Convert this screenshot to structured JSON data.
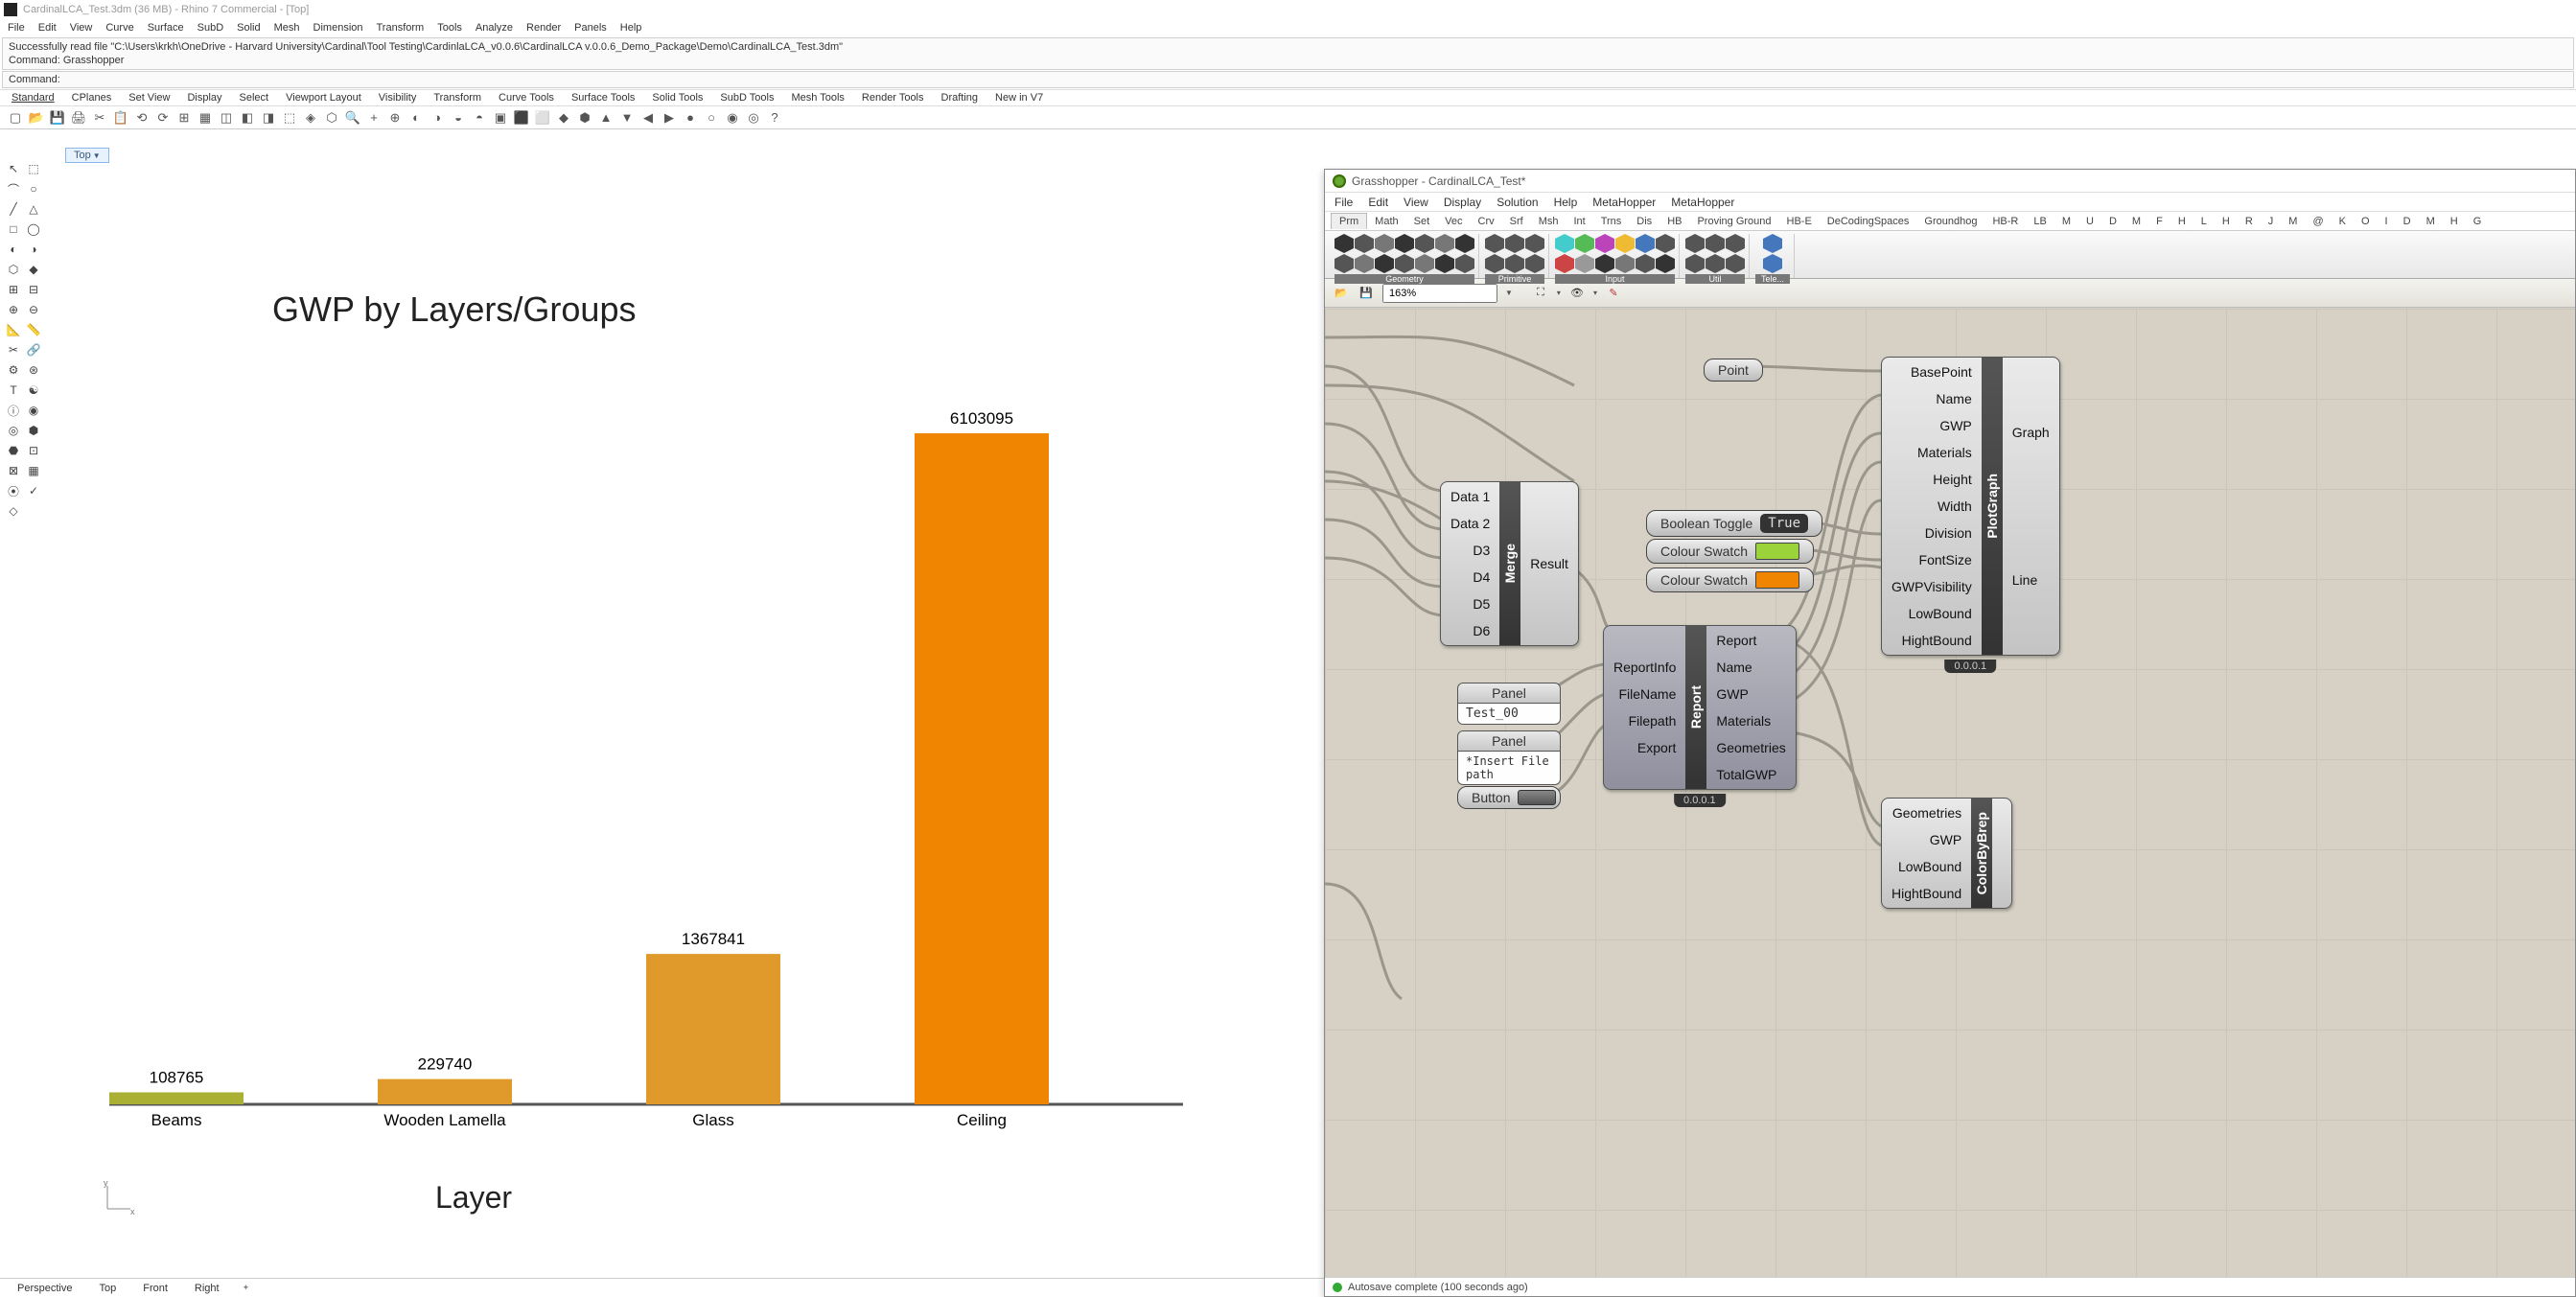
{
  "title": "CardinalLCA_Test.3dm (36 MB) - Rhino 7 Commercial - [Top]",
  "rhmenu": [
    "File",
    "Edit",
    "View",
    "Curve",
    "Surface",
    "SubD",
    "Solid",
    "Mesh",
    "Dimension",
    "Transform",
    "Tools",
    "Analyze",
    "Render",
    "Panels",
    "Help"
  ],
  "cmd_line1": "Successfully read file \"C:\\Users\\krkh\\OneDrive - Harvard University\\Cardinal\\Tool Testing\\CardinlaLCA_v0.0.6\\CardinalLCA v.0.0.6_Demo_Package\\Demo\\CardinalLCA_Test.3dm\"",
  "cmd_line2": "Command: Grasshopper",
  "cmd_prompt": "Command:",
  "tabtoolbar": [
    "Standard",
    "CPlanes",
    "Set View",
    "Display",
    "Select",
    "Viewport Layout",
    "Visibility",
    "Transform",
    "Curve Tools",
    "Surface Tools",
    "Solid Tools",
    "SubD Tools",
    "Mesh Tools",
    "Render Tools",
    "Drafting",
    "New in V7"
  ],
  "viewlabel": "Top",
  "chart_data": {
    "type": "bar",
    "title": "GWP by Layers/Groups",
    "xlabel": "Layer",
    "categories": [
      "Beams",
      "Wooden Lamella",
      "Glass",
      "Ceiling"
    ],
    "values": [
      108765,
      229740,
      1367841,
      6103095
    ],
    "colors": [
      "#aab033",
      "#e09a2b",
      "#e09a2b",
      "#ef8500"
    ]
  },
  "footer_tabs": [
    "Perspective",
    "Top",
    "Front",
    "Right"
  ],
  "gh": {
    "title": "Grasshopper - CardinalLCA_Test*",
    "menu": [
      "File",
      "Edit",
      "View",
      "Display",
      "Solution",
      "Help",
      "MetaHopper",
      "MetaHopper"
    ],
    "tabs": [
      "Prm",
      "Math",
      "Set",
      "Vec",
      "Crv",
      "Srf",
      "Msh",
      "Int",
      "Trns",
      "Dis",
      "HB",
      "Proving Ground",
      "HB-E",
      "DeCodingSpaces",
      "Groundhog",
      "HB-R",
      "LB",
      "M",
      "U",
      "D",
      "M",
      "F",
      "H",
      "L",
      "H",
      "R",
      "J",
      "M",
      "@",
      "K",
      "O",
      "I",
      "D",
      "M",
      "H",
      "G"
    ],
    "ribbon_groups": [
      "Geometry",
      "Primitive",
      "Input",
      "Util",
      "Tele..."
    ],
    "zoom": "163%",
    "status": "Autosave complete (100 seconds ago)",
    "point_label": "Point",
    "bool_toggle": {
      "label": "Boolean Toggle",
      "value": "True"
    },
    "swatch1_label": "Colour Swatch",
    "swatch2_label": "Colour Swatch",
    "swatch1_color": "#9bd33b",
    "swatch2_color": "#ef8500",
    "merge": {
      "inputs": [
        "Data 1",
        "Data 2",
        "D3",
        "D4",
        "D5",
        "D6"
      ],
      "name": "Merge",
      "out": "Result"
    },
    "panel1": {
      "hdr": "Panel",
      "body": "Test_00"
    },
    "panel2": {
      "hdr": "Panel",
      "body": "*Insert File path"
    },
    "button_label": "Button",
    "report": {
      "name": "Report",
      "ver": "0.0.0.1",
      "inputs": [
        "ReportInfo",
        "FileName",
        "Filepath",
        "Export"
      ],
      "outputs": [
        "Report",
        "Name",
        "GWP",
        "Materials",
        "Geometries",
        "TotalGWP"
      ]
    },
    "plotgraph": {
      "name": "PlotGraph",
      "ver": "0.0.0.1",
      "inputs": [
        "BasePoint",
        "Name",
        "GWP",
        "Materials",
        "Height",
        "Width",
        "Division",
        "FontSize",
        "GWPVisibility",
        "LowBound",
        "HightBound"
      ],
      "outputs": [
        "Graph",
        "Line"
      ]
    },
    "colorbybrep": {
      "name": "ColorByBrep",
      "inputs": [
        "Geometries",
        "GWP",
        "LowBound",
        "HightBound"
      ]
    }
  }
}
